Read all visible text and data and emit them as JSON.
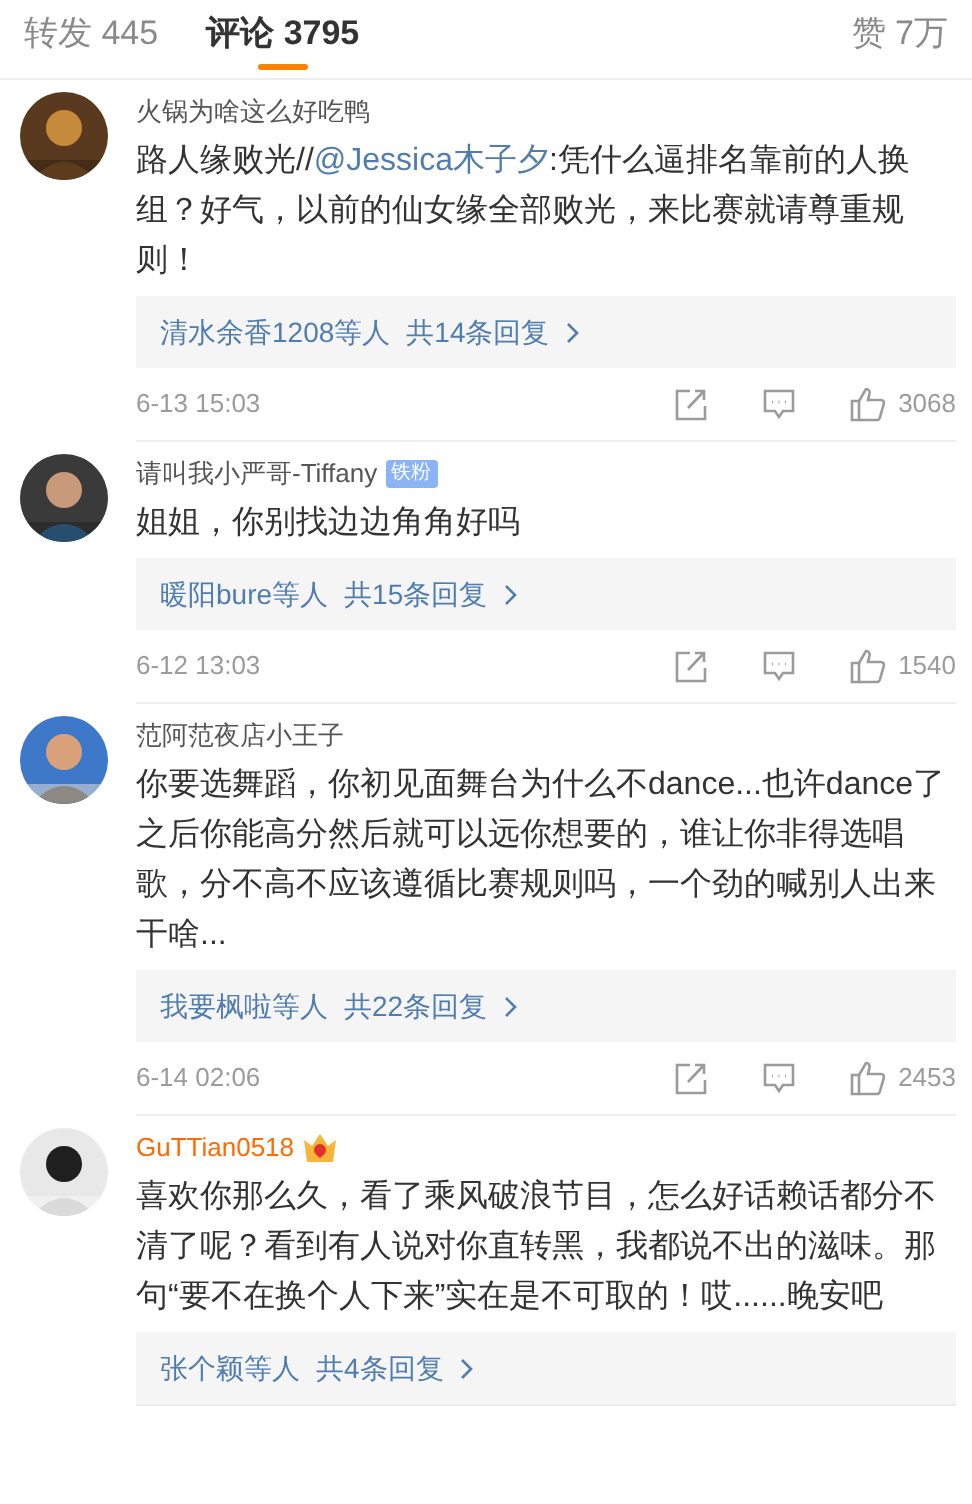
{
  "tabs": [
    {
      "label": "转发 445",
      "selected": false
    },
    {
      "label": "评论 3795",
      "selected": true
    }
  ],
  "likes_total": "赞 7万",
  "comments": [
    {
      "name": "火锅为啥这么好吃鸭",
      "vip": false,
      "avatar": {
        "kind": "picture"
      },
      "segments": [
        {
          "kind": "plain",
          "text": "路人缘败光//"
        },
        {
          "kind": "mention",
          "text": "@Jessica木子夕"
        },
        {
          "kind": "plain",
          "text": ":凭什么逼排名靠前的人换组？好气，以前的仙女缘全部败光，来比赛就请尊重规则！"
        }
      ],
      "replies": {
        "who": "清水余香1208等人",
        "count": "共14条回复"
      },
      "time": "6-13 15:03",
      "likes": "3068"
    },
    {
      "name": "请叫我小严哥-Tiffany",
      "badge": "铁粉",
      "vip": false,
      "avatar": {
        "kind": "picture"
      },
      "segments": [
        {
          "kind": "plain",
          "text": "姐姐，你别找边边角角好吗"
        }
      ],
      "replies": {
        "who": "暖阳bure等人",
        "count": "共15条回复"
      },
      "time": "6-12 13:03",
      "likes": "1540"
    },
    {
      "name": "范阿范夜店小王子",
      "vip": false,
      "avatar": {
        "kind": "picture"
      },
      "segments": [
        {
          "kind": "plain",
          "text": "你要选舞蹈，你初见面舞台为什么不dance...也许dance了之后你能高分然后就可以远你想要的，谁让你非得选唱歌，分不高不应该遵循比赛规则吗，一个劲的喊别人出来干啥..."
        }
      ],
      "replies": {
        "who": "我要枫啦等人",
        "count": "共22条回复"
      },
      "time": "6-14 02:06",
      "likes": "2453"
    },
    {
      "name": "GuTTian0518",
      "vip": true,
      "avatar": {
        "kind": "picture"
      },
      "segments": [
        {
          "kind": "plain",
          "text": "喜欢你那么久，看了乘风破浪节目，怎么好话赖话都分不清了呢？看到有人说对你直转黑，我都说不出的滋味。那句“要不在换个人下来”实在是不可取的！哎......晚安吧"
        }
      ],
      "replies": {
        "who": "张个颖等人",
        "count": "共4条回复"
      }
    }
  ]
}
